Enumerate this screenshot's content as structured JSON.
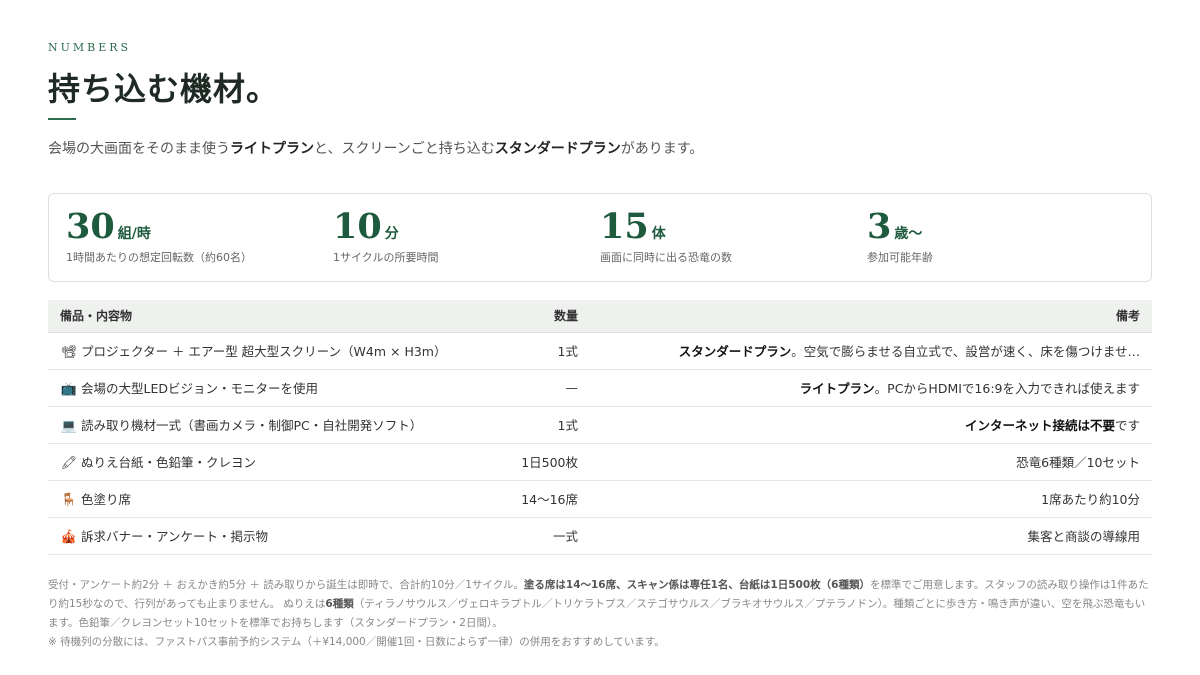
{
  "header": {
    "kicker": "NUMBERS",
    "title": "持ち込む機材。"
  },
  "lead": {
    "p1": "会場の大画面をそのまま使う",
    "b1": "ライトプラン",
    "p2": "と、スクリーンごと持ち込む",
    "b2": "スタンダードプラン",
    "p3": "があります。"
  },
  "stats": [
    {
      "num": "30",
      "unit": "組/時",
      "label": "1時間あたりの想定回転数（約60名）"
    },
    {
      "num": "10",
      "unit": "分",
      "label": "1サイクルの所要時間"
    },
    {
      "num": "15",
      "unit": "体",
      "label": "画面に同時に出る恐竜の数"
    },
    {
      "num": "3",
      "unit": "歳〜",
      "label": "参加可能年齢"
    }
  ],
  "table": {
    "headers": {
      "item": "備品・内容物",
      "qty": "数量",
      "note": "備考"
    },
    "rows": [
      {
        "icon": "📽",
        "item": "プロジェクター ＋ エアー型 超大型スクリーン（W4m × H3m）",
        "qty": "1式",
        "note_b": "スタンダードプラン",
        "note": "。空気で膨らませる自立式で、設営が速く、床を傷つけませ…"
      },
      {
        "icon": "📺",
        "item": "会場の大型LEDビジョン・モニターを使用",
        "qty": "—",
        "note_b": "ライトプラン",
        "note": "。PCからHDMIで16:9を入力できれば使えます"
      },
      {
        "icon": "💻",
        "item": "読み取り機材一式（書画カメラ・制御PC・自社開発ソフト）",
        "qty": "1式",
        "note_b": "インターネット接続は不要",
        "note": "です"
      },
      {
        "icon": "🖍",
        "item": "ぬりえ台紙・色鉛筆・クレヨン",
        "qty": "1日500枚",
        "note_b": "",
        "note": "恐竜6種類／10セット"
      },
      {
        "icon": "🪑",
        "item": "色塗り席",
        "qty": "14〜16席",
        "note_b": "",
        "note": "1席あたり約10分"
      },
      {
        "icon": "🎪",
        "item": "訴求バナー・アンケート・掲示物",
        "qty": "一式",
        "note_b": "",
        "note": "集客と商談の導線用"
      }
    ]
  },
  "footnote": {
    "t1": "受付・アンケート約2分 ＋ おえかき約5分 ＋ 読み取りから誕生は即時で、合計約10分／1サイクル。",
    "b1": "塗る席は14〜16席、スキャン係は専任1名、台紙は1日500枚（6種類）",
    "t2": "を標準でご用意します。スタッフの読み取り操作は1件あたり約15秒なので、行列があっても止まりません。 ぬりえは",
    "b2": "6種類",
    "t3": "（ティラノサウルス／ヴェロキラプトル／トリケラトプス／ステゴサウルス／ブラキオサウルス／プテラノドン）。種類ごとに歩き方・鳴き声が違い、空を飛ぶ恐竜もいます。色鉛筆／クレヨンセット10セットを標準でお持ちします（スタンダードプラン・2日間）。",
    "line2": "※ 待機列の分散には、ファストパス事前予約システム（＋¥14,000／開催1回・日数によらず一律）の併用をおすすめしています。"
  }
}
